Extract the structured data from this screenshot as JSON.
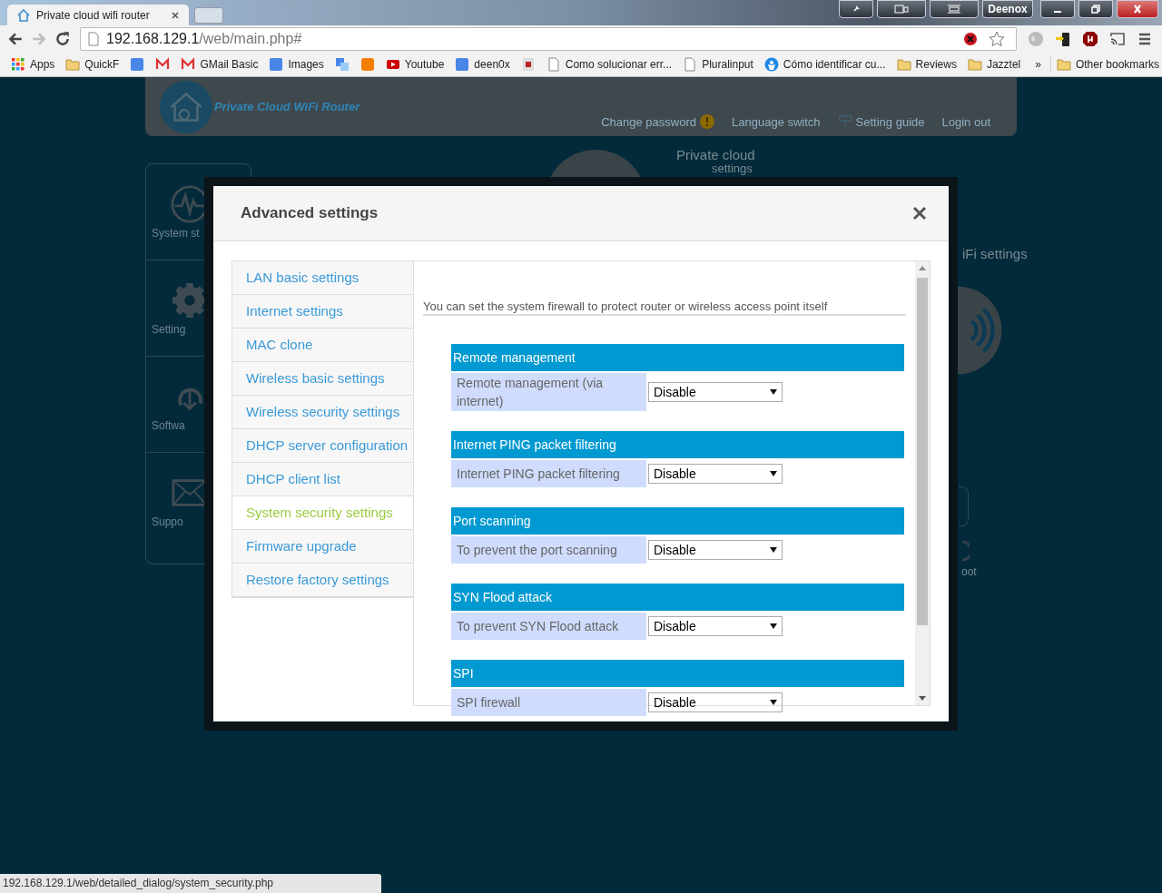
{
  "browser": {
    "tab": {
      "title": "Private cloud wifi router"
    },
    "window_user": "Deenox",
    "address": {
      "host": "192.168.129.1",
      "path": "/web/main.php#"
    },
    "bookmarks": [
      {
        "kind": "apps",
        "label": "Apps"
      },
      {
        "kind": "folder",
        "label": "QuickF"
      },
      {
        "kind": "square"
      },
      {
        "kind": "mail"
      },
      {
        "kind": "mail",
        "label": "GMail Basic"
      },
      {
        "kind": "square",
        "label": "Images"
      },
      {
        "kind": "translate"
      },
      {
        "kind": "orange"
      },
      {
        "kind": "play",
        "label": "Youtube"
      },
      {
        "kind": "square",
        "label": "deen0x"
      },
      {
        "kind": "document"
      },
      {
        "kind": "page",
        "label": "Como solucionar err..."
      },
      {
        "kind": "page",
        "label": "Pluralinput"
      },
      {
        "kind": "person",
        "label": "Cómo identificar cu..."
      },
      {
        "kind": "folder",
        "label": "Reviews"
      },
      {
        "kind": "folder",
        "label": "Jazztel"
      }
    ],
    "overflow": "»",
    "other_bookmarks": "Other bookmarks"
  },
  "router_page": {
    "logo_text": "Private Cloud WiFi Router",
    "header_links": [
      {
        "label": "Change password",
        "kind": "alert"
      },
      {
        "label": "Language switch",
        "kind": "plain"
      },
      {
        "label": "Setting guide",
        "kind": "guide"
      },
      {
        "label": "Login out",
        "kind": "plain"
      }
    ],
    "sidebar": [
      {
        "kind": "status",
        "label": "System st"
      },
      {
        "kind": "settings",
        "label": "Setting"
      },
      {
        "kind": "software",
        "label": "Softwa"
      },
      {
        "kind": "support",
        "label": "Suppo"
      }
    ],
    "tiles": [
      {
        "kind": "cloud",
        "label": "Private cloud"
      },
      {
        "kind": "caption",
        "label": "settings"
      },
      {
        "kind": "wifi",
        "label": "iFi settings"
      },
      {
        "kind": "reboot",
        "label": "oot"
      }
    ]
  },
  "dialog": {
    "title": "Advanced settings",
    "menu": [
      {
        "label": "LAN basic settings",
        "selected": false
      },
      {
        "label": "Internet settings",
        "selected": false
      },
      {
        "label": "MAC clone",
        "selected": false
      },
      {
        "label": "Wireless basic settings",
        "selected": false
      },
      {
        "label": "Wireless security settings",
        "selected": false
      },
      {
        "label": "DHCP server configuration",
        "selected": false
      },
      {
        "label": "DHCP client list",
        "selected": false
      },
      {
        "label": "System security settings",
        "selected": true
      },
      {
        "label": "Firmware upgrade",
        "selected": false
      },
      {
        "label": "Restore factory settings",
        "selected": false
      }
    ],
    "description": "You can set the system firewall to protect router or wireless access point itself",
    "sections": [
      {
        "title": "Remote management",
        "label": "Remote management (via internet)",
        "value": "Disable"
      },
      {
        "title": "Internet PING packet filtering",
        "label": "Internet PING packet filtering",
        "value": "Disable"
      },
      {
        "title": "Port scanning",
        "label": "To prevent the port scanning",
        "value": "Disable"
      },
      {
        "title": "SYN Flood attack",
        "label": "To prevent SYN Flood attack",
        "value": "Disable"
      },
      {
        "title": "SPI",
        "label": "SPI firewall",
        "value": "Disable"
      }
    ]
  },
  "status_bar": "192.168.129.1/web/detailed_dialog/system_security.php"
}
